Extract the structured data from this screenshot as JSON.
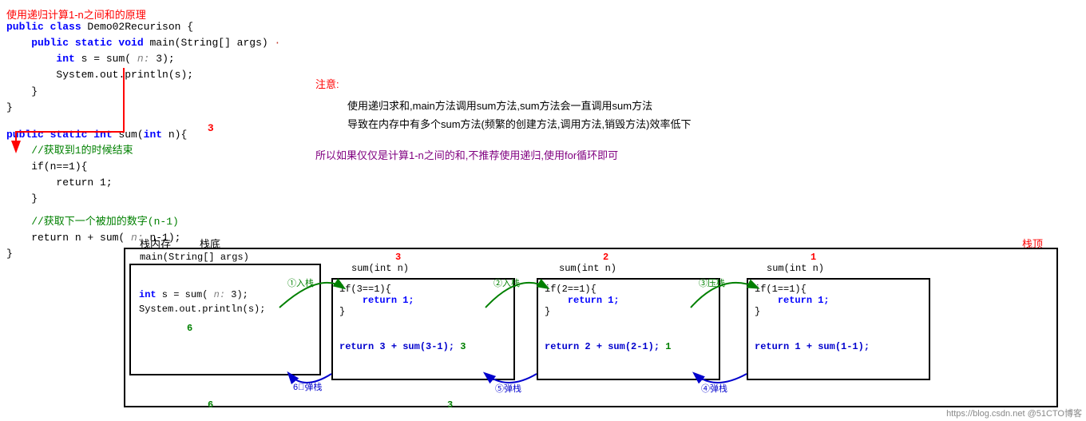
{
  "title": "使用递归计算1-n之间和的原理",
  "code": {
    "class_line": "public class Demo02Recurison {",
    "main_line": "    public static void main(String[] args) {",
    "int_line": "        int s = sum( n: 3);",
    "print_line": "        System.out.println(s);",
    "close1": "    }",
    "sum_sig": "public static int sum(int n){",
    "comment1": "    //获取到1的时候结束",
    "if_line": "    if(n==1){",
    "return1": "        return 1;",
    "close2": "    }",
    "comment2": "    //获取下一个被加的数字(n-1)",
    "return_n": "    return n + sum( n: n-1);",
    "close3": "}"
  },
  "notice": {
    "title": "注意:",
    "line1": "使用递归求和,main方法调用sum方法,sum方法会一直调用sum方法",
    "line2": "导致在内存中有多个sum方法(频繁的创建方法,调用方法,销毁方法)效率低下",
    "conclusion": "所以如果仅仅是计算1-n之间的和,不推荐使用递归,使用for循环即可"
  },
  "stack": {
    "label_neicun": "栈内存",
    "label_zhan": "栈底",
    "label_zhaniding": "栈顶",
    "main_frame": {
      "header": "main(String[] args)",
      "line1": "int s = sum( n: 3);",
      "line2": "System.out.println(s);",
      "num6": "6"
    },
    "sum3_frame": {
      "num": "3",
      "header": "sum(int n)",
      "step_in": "①入栈",
      "if_line": "if(3==1){",
      "return1": "    return 1;",
      "close": "}",
      "return_line": "return 3 + sum(3-1);",
      "val3": "3",
      "step5": "⑤弹栈"
    },
    "sum2_frame": {
      "num": "2",
      "header": "sum(int n)",
      "step_in": "②入栈",
      "if_line": "if(2==1){",
      "return1": "    return 1;",
      "close": "}",
      "return_line": "return 2 + sum(2-1);",
      "val1": "1",
      "step4": "④弹栈"
    },
    "sum1_frame": {
      "num": "1",
      "header": "sum(int n)",
      "step_in": "③压栈",
      "if_line": "if(1==1){",
      "return1": "    return 1;",
      "close": "}",
      "return_line": "return 1 + sum(1-1);"
    },
    "step6_弹栈": "6⃣弹栈",
    "val6": "6",
    "val3_bottom": "3"
  }
}
